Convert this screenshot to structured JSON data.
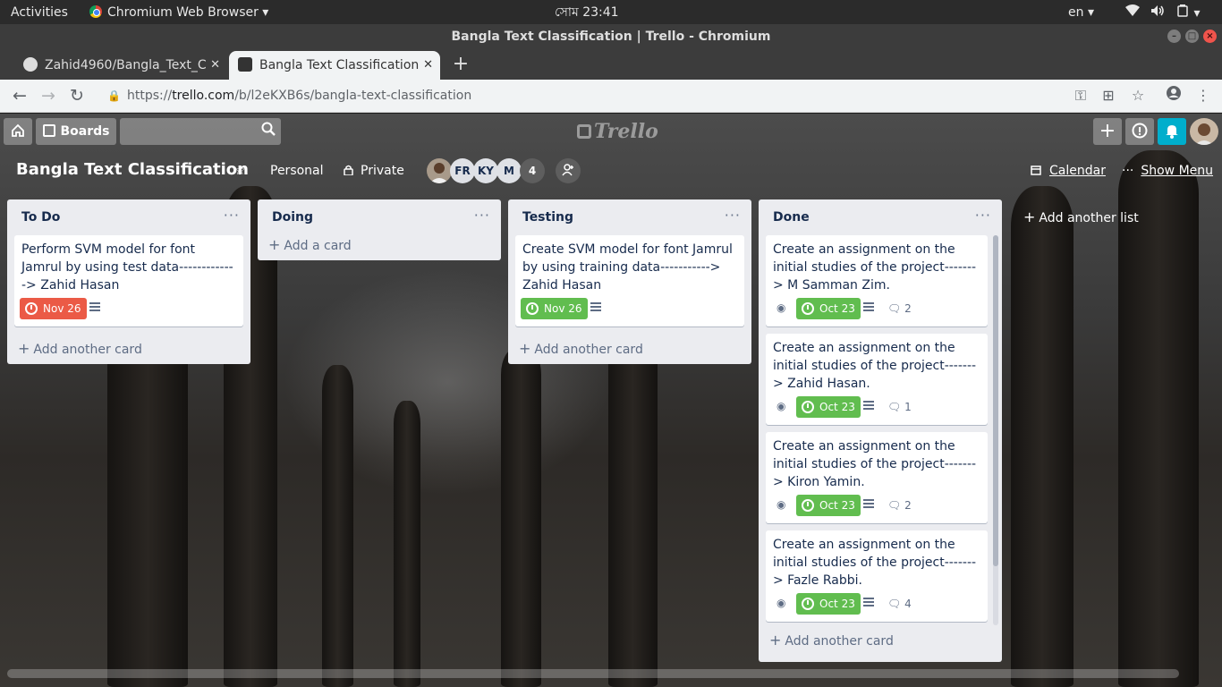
{
  "system": {
    "activities": "Activities",
    "app_menu": "Chromium Web Browser",
    "clock": "সোম 23:41",
    "language": "en"
  },
  "window": {
    "title": "Bangla Text Classification | Trello - Chromium"
  },
  "tabs": [
    {
      "label": "Zahid4960/Bangla_Text_C"
    },
    {
      "label": "Bangla Text Classification"
    }
  ],
  "address": {
    "scheme": "https://",
    "host": "trello.com",
    "path": "/b/l2eKXB6s/bangla-text-classification"
  },
  "header": {
    "boards_label": "Boards",
    "logo_text": "Trello"
  },
  "board": {
    "title": "Bangla Text Classification",
    "team": "Personal",
    "visibility": "Private",
    "members": [
      "FR",
      "KY",
      "M"
    ],
    "member_count": "4",
    "calendar": "Calendar",
    "show_menu": "Show Menu"
  },
  "lists": [
    {
      "title": "To Do",
      "cards": [
        {
          "text": "Perform SVM model for font Jamrul by using test data-------------> Zahid Hasan",
          "due": "Nov 26"
        }
      ],
      "add_label": "Add another card"
    },
    {
      "title": "Doing",
      "cards": [],
      "add_label": "Add a card"
    },
    {
      "title": "Testing",
      "cards": [
        {
          "text": "Create SVM model for font Jamrul by using training data-----------> Zahid Hasan",
          "due": "Nov 26"
        }
      ],
      "add_label": "Add another card"
    },
    {
      "title": "Done",
      "cards": [
        {
          "text": "Create an assignment on the initial studies of the project-------> M Samman Zim.",
          "due": "Oct 23",
          "comments": "2"
        },
        {
          "text": "Create an assignment on the initial studies of the project-------> Zahid Hasan.",
          "due": "Oct 23",
          "comments": "1"
        },
        {
          "text": "Create an assignment on the initial studies of the project-------> Kiron Yamin.",
          "due": "Oct 23",
          "comments": "2"
        },
        {
          "text": "Create an assignment on the initial studies of the project-------> Fazle Rabbi.",
          "due": "Oct 23",
          "comments": "4"
        }
      ],
      "add_label": "Add another card"
    }
  ],
  "add_list_label": "Add another list",
  "colors": {
    "due_overdue": "#eb5a46",
    "due_complete": "#61bd4f",
    "list_bg": "#ebecf0",
    "notification": "#00aecc"
  }
}
